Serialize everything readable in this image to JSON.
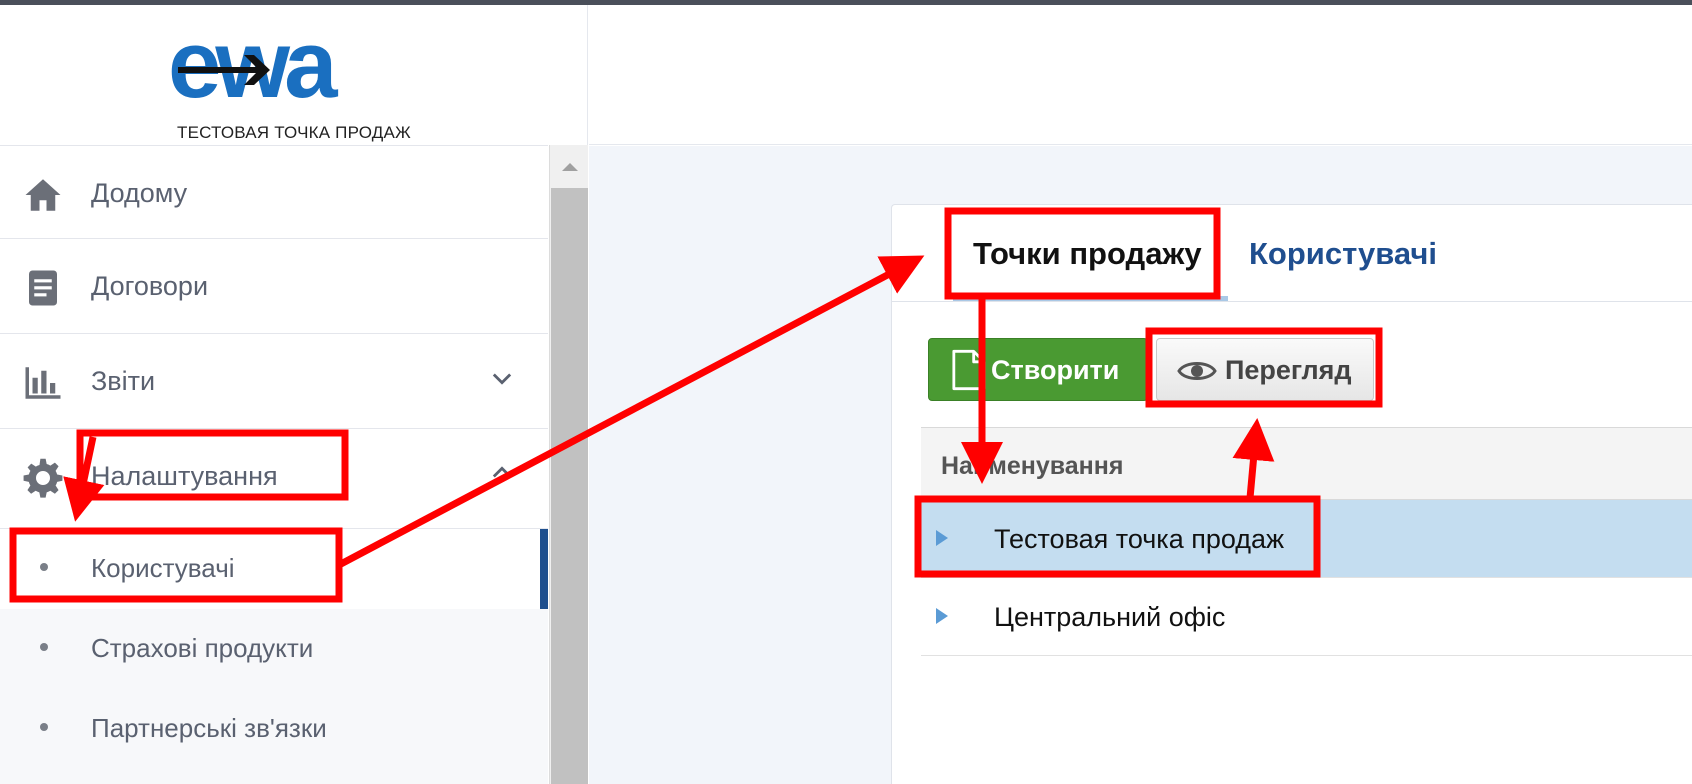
{
  "header": {
    "logo_text": "ewa",
    "subtitle": "ТЕСТОВАЯ ТОЧКА ПРОДАЖ"
  },
  "sidebar": {
    "items": [
      {
        "label": "Додому",
        "icon": "home-icon"
      },
      {
        "label": "Договори",
        "icon": "document-icon"
      },
      {
        "label": "Звіти",
        "icon": "bar-chart-icon",
        "chevron": "chevron-down-icon"
      },
      {
        "label": "Налаштування",
        "icon": "gear-icon",
        "chevron": "chevron-up-icon"
      }
    ],
    "subitems": [
      {
        "label": "Користувачі",
        "active": true
      },
      {
        "label": "Страхові продукти"
      },
      {
        "label": "Партнерські зв'язки"
      }
    ]
  },
  "main": {
    "tabs": [
      {
        "label": "Точки продажу",
        "active": true
      },
      {
        "label": "Користувачі"
      }
    ],
    "toolbar": {
      "create_label": "Створити",
      "view_label": "Перегляд"
    },
    "grid": {
      "column_header": "Найменування",
      "rows": [
        {
          "name": "Тестовая точка продаж",
          "selected": true
        },
        {
          "name": "Центральний офіс"
        }
      ]
    }
  },
  "colors": {
    "brand_blue": "#1a6fc0",
    "create_green": "#4a9a32",
    "selected_row": "#c4ddf0",
    "annotation_red": "#ff0000",
    "active_bar": "#1e4f8e"
  }
}
